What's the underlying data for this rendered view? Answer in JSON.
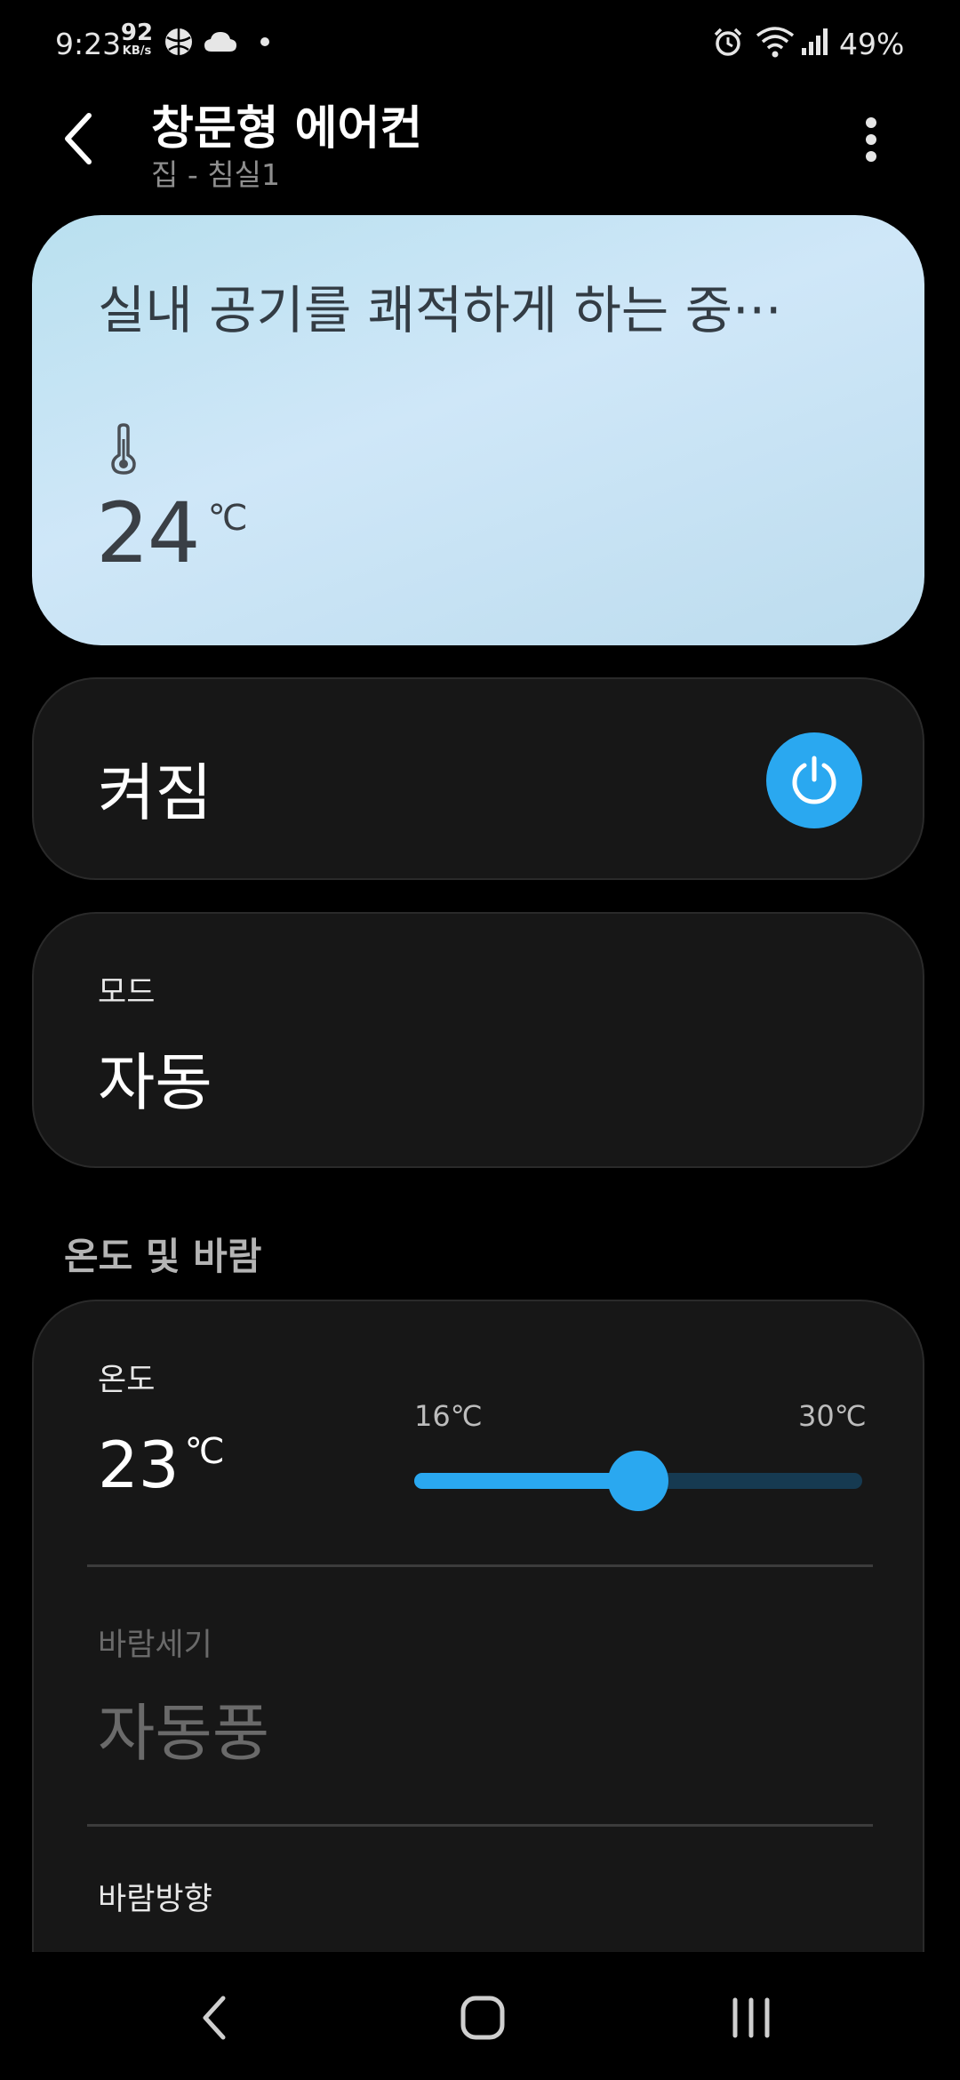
{
  "status_bar": {
    "time": "9:23",
    "network_speed": "92",
    "network_speed_unit": "KB/s",
    "battery": "49%",
    "icons": [
      "ball-icon",
      "cloud-icon",
      "notification-dot-icon",
      "alarm-icon",
      "wifi-icon",
      "signal-icon"
    ]
  },
  "header": {
    "title": "창문형 에어컨",
    "subtitle": "집 - 침실1",
    "back_icon": "back-arrow-icon",
    "more_icon": "more-vertical-icon"
  },
  "status_card": {
    "message": "실내 공기를 쾌적하게 하는 중···",
    "indoor_temperature": "24",
    "unit": "℃",
    "icon": "thermometer-icon"
  },
  "power": {
    "label": "켜짐",
    "is_on": true,
    "icon": "power-icon",
    "accent": "#2aa8f0"
  },
  "mode": {
    "label": "모드",
    "value": "자동"
  },
  "section": {
    "title": "온도 및 바람"
  },
  "temperature": {
    "label": "온도",
    "value": "23",
    "unit": "℃",
    "min_label": "16℃",
    "max_label": "30℃",
    "min": 16,
    "max": 30,
    "current": 23
  },
  "wind": {
    "label": "바람세기",
    "value": "자동풍"
  },
  "wind_direction": {
    "label": "바람방향"
  },
  "nav_bar": {
    "icons": [
      "nav-back-icon",
      "nav-home-icon",
      "nav-recent-apps-icon"
    ]
  },
  "colors": {
    "background": "#000000",
    "card": "#171717",
    "status_card": "#cfe7f8",
    "accent": "#2aa8f0",
    "slider_track": "#163a51",
    "muted_text": "#6a6a6a"
  }
}
